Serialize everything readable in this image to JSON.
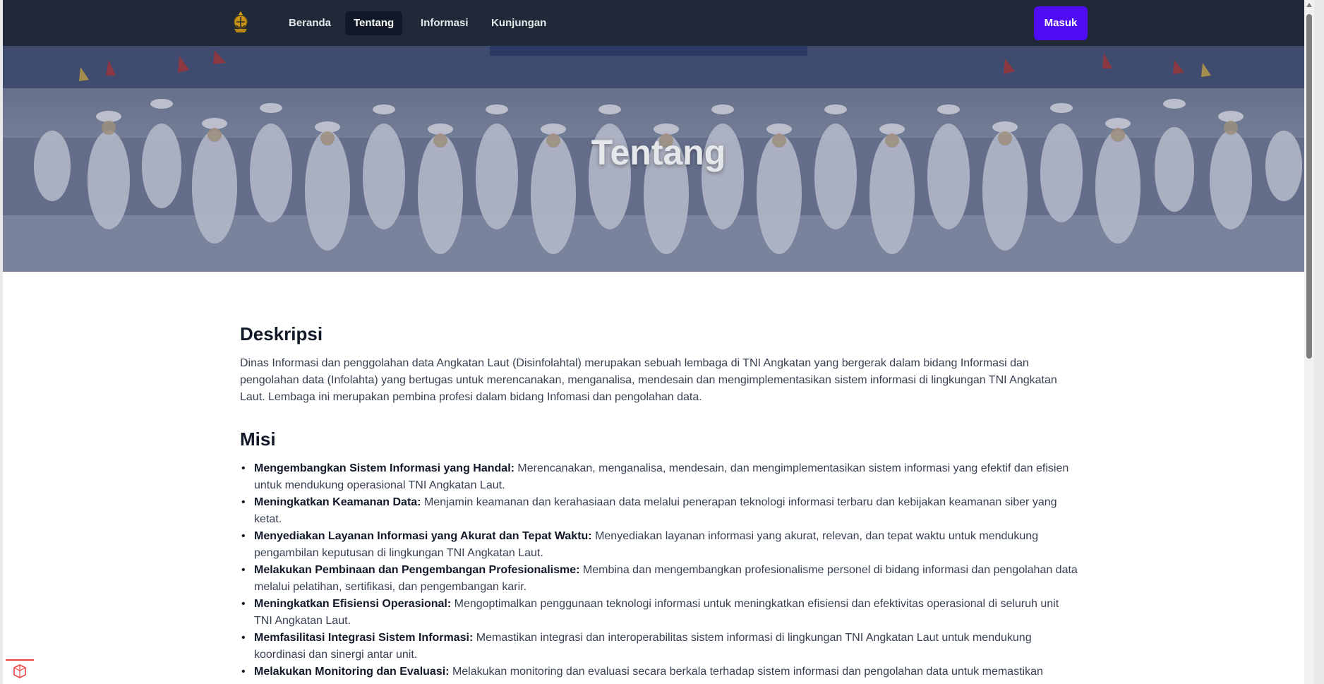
{
  "nav": {
    "items": [
      {
        "label": "Beranda",
        "active": false
      },
      {
        "label": "Tentang",
        "active": true
      },
      {
        "label": "Informasi",
        "active": false
      },
      {
        "label": "Kunjungan",
        "active": false
      }
    ],
    "login_label": "Masuk",
    "logo_icon": "navy-emblem-icon"
  },
  "hero": {
    "title": "Tentang"
  },
  "deskripsi": {
    "heading": "Deskripsi",
    "text": "Dinas Informasi dan penggolahan data Angkatan Laut (Disinfolahtal) merupakan sebuah lembaga di TNI Angkatan yang bergerak dalam bidang Informasi dan pengolahan data (Infolahta) yang bertugas untuk merencanakan, menganalisa, mendesain dan mengimplementasikan sistem informasi di lingkungan TNI Angkatan Laut. Lembaga ini merupakan pembina profesi dalam bidang Infomasi dan pengolahan data."
  },
  "misi": {
    "heading": "Misi",
    "items": [
      {
        "title": "Mengembangkan Sistem Informasi yang Handal:",
        "text": " Merencanakan, menganalisa, mendesain, dan mengimplementasikan sistem informasi yang efektif dan efisien untuk mendukung operasional TNI Angkatan Laut."
      },
      {
        "title": "Meningkatkan Keamanan Data:",
        "text": " Menjamin keamanan dan kerahasiaan data melalui penerapan teknologi informasi terbaru dan kebijakan keamanan siber yang ketat."
      },
      {
        "title": "Menyediakan Layanan Informasi yang Akurat dan Tepat Waktu:",
        "text": " Menyediakan layanan informasi yang akurat, relevan, dan tepat waktu untuk mendukung pengambilan keputusan di lingkungan TNI Angkatan Laut."
      },
      {
        "title": "Melakukan Pembinaan dan Pengembangan Profesionalisme:",
        "text": " Membina dan mengembangkan profesionalisme personel di bidang informasi dan pengolahan data melalui pelatihan, sertifikasi, dan pengembangan karir."
      },
      {
        "title": "Meningkatkan Efisiensi Operasional:",
        "text": " Mengoptimalkan penggunaan teknologi informasi untuk meningkatkan efisiensi dan efektivitas operasional di seluruh unit TNI Angkatan Laut."
      },
      {
        "title": "Memfasilitasi Integrasi Sistem Informasi:",
        "text": " Memastikan integrasi dan interoperabilitas sistem informasi di lingkungan TNI Angkatan Laut untuk mendukung koordinasi dan sinergi antar unit."
      },
      {
        "title": "Melakukan Monitoring dan Evaluasi:",
        "text": " Melakukan monitoring dan evaluasi secara berkala terhadap sistem informasi dan pengolahan data untuk memastikan"
      }
    ]
  },
  "colors": {
    "navbar": "#1f2937",
    "accent": "#4f0df5",
    "active_nav": "#111827"
  }
}
